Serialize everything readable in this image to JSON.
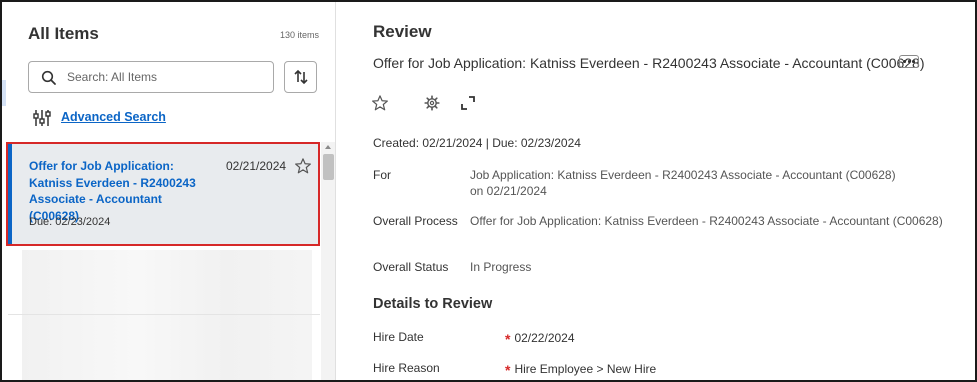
{
  "left_panel": {
    "title": "All Items",
    "count": "130 items",
    "search": {
      "placeholder": "Search: All Items",
      "value": ""
    },
    "advanced_search": "Advanced Search",
    "items": [
      {
        "title": "Offer for Job Application: Katniss Everdeen - R2400243 Associate - Accountant (C00628)",
        "date": "02/21/2024",
        "due": "Due: 02/23/2024"
      }
    ]
  },
  "review": {
    "title": "Review",
    "subtitle": "Offer for Job Application: Katniss Everdeen - R2400243 Associate - Accountant (C00628)",
    "meta": "Created: 02/21/2024 | Due: 02/23/2024",
    "fields": [
      {
        "label": "For",
        "value": "Job Application: Katniss Everdeen - R2400243 Associate - Accountant (C00628) on 02/21/2024"
      },
      {
        "label": "Overall Process",
        "value": "Offer for Job Application: Katniss Everdeen - R2400243 Associate - Accountant (C00628)"
      },
      {
        "label": "Overall Status",
        "value": "In Progress"
      }
    ],
    "details_title": "Details to Review",
    "details": [
      {
        "label": "Hire Date",
        "required": "*",
        "value": "02/22/2024"
      },
      {
        "label": "Hire Reason",
        "required": "*",
        "value": "Hire Employee > New Hire"
      }
    ]
  },
  "colors": {
    "link": "#0b65c6",
    "selected_border": "#d62828",
    "selected_bg": "#e8ebee",
    "required": "#d62828"
  },
  "icons": [
    "search-icon",
    "sort-icon",
    "filter-sliders-icon",
    "star-icon",
    "gear-icon",
    "expand-icon",
    "more-icon"
  ]
}
